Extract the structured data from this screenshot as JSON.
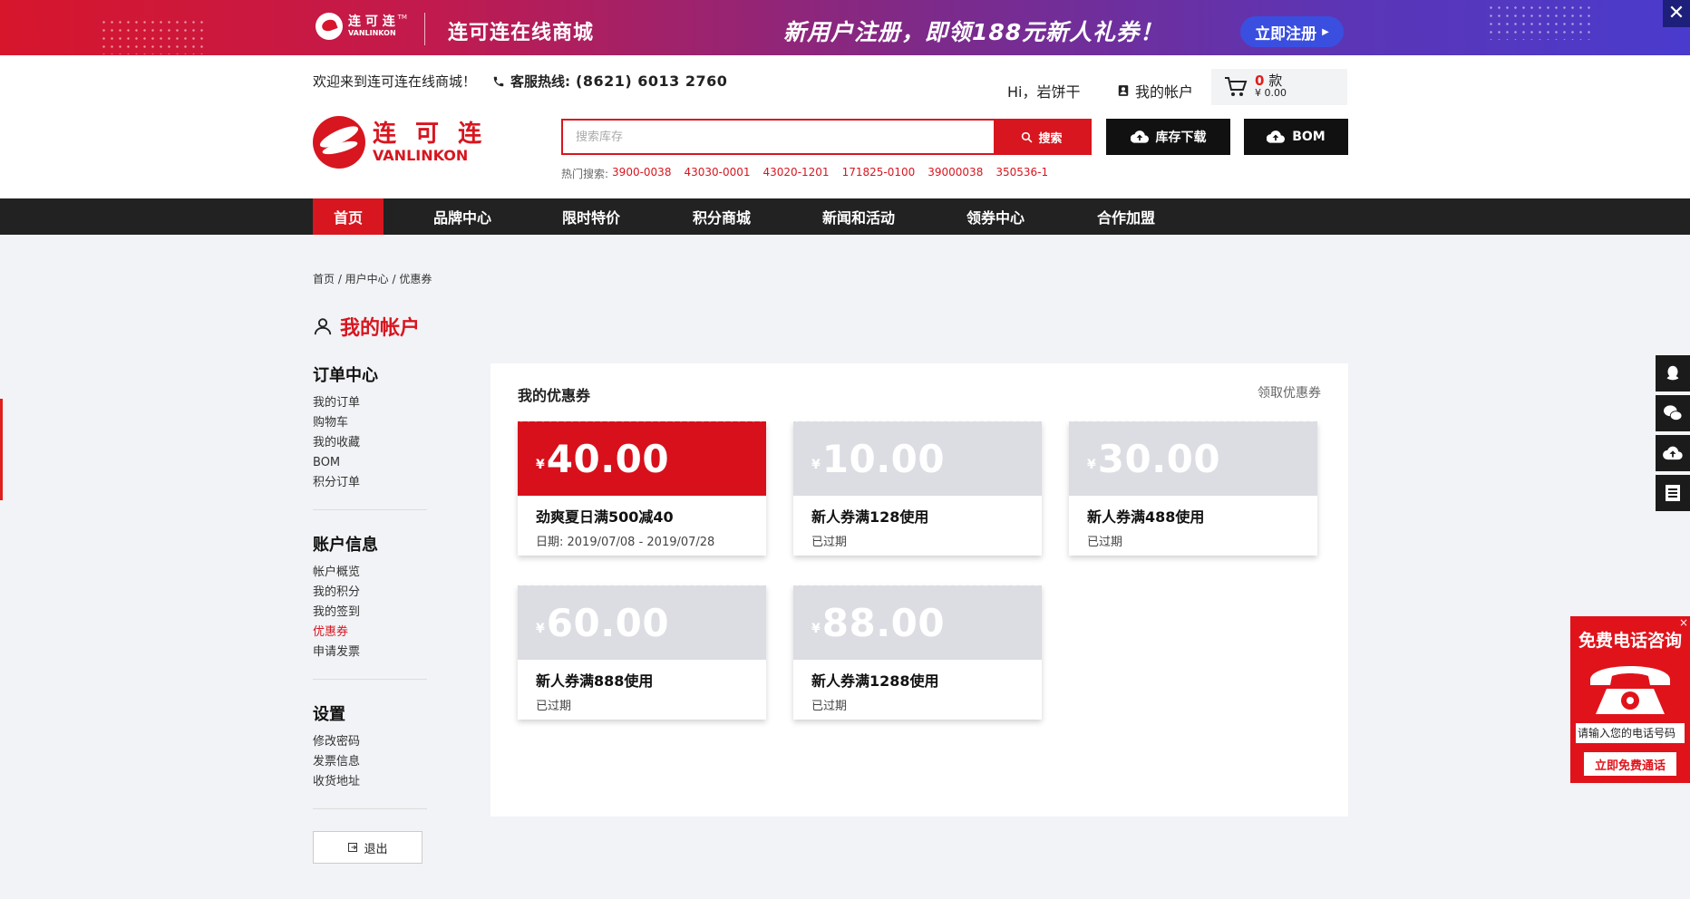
{
  "promo": {
    "logo_cn": "连 可 连",
    "logo_en": "VANLINKON",
    "logo_tm": "TM",
    "site_name": "连可连在线商城",
    "slogan": "新用户注册，即领188元新人礼券！",
    "register_btn": "立即注册",
    "close": "✕"
  },
  "header": {
    "welcome": "欢迎来到连可连在线商城！",
    "hotline_label": "客服热线:",
    "hotline_number": "(8621) 6013 2760",
    "greeting": "Hi，岩饼干",
    "account_link": "我的帐户",
    "cart_count_num": "0",
    "cart_count_unit": "款",
    "cart_price": "¥ 0.00",
    "logo_cn": "连 可 连",
    "logo_en": "VANLINKON"
  },
  "search": {
    "placeholder": "搜索库存",
    "button": "搜索",
    "stock_download": "库存下载",
    "bom": "BOM",
    "hot_label": "热门搜索:",
    "hot_keywords": [
      "3900-0038",
      "43030-0001",
      "43020-1201",
      "171825-0100",
      "39000038",
      "350536-1"
    ]
  },
  "nav": {
    "items": [
      "首页",
      "品牌中心",
      "限时特价",
      "积分商城",
      "新闻和活动",
      "领券中心",
      "合作加盟"
    ]
  },
  "breadcrumb": "首页 / 用户中心 / 优惠券",
  "account_title": "我的帐户",
  "sidebar": {
    "groups": [
      {
        "title": "订单中心",
        "items": [
          "我的订单",
          "购物车",
          "我的收藏",
          "BOM",
          "积分订单"
        ]
      },
      {
        "title": "账户信息",
        "items": [
          "帐户概览",
          "我的积分",
          "我的签到",
          "优惠券",
          "申请发票"
        ]
      },
      {
        "title": "设置",
        "items": [
          "修改密码",
          "发票信息",
          "收货地址"
        ]
      }
    ],
    "logout": "退出"
  },
  "panel": {
    "title": "我的优惠券",
    "get_coupon_link": "领取优惠券",
    "coupons": [
      {
        "currency": "¥",
        "amount": "40.00",
        "name": "劲爽夏日满500减40",
        "meta": "日期:  2019/07/08 - 2019/07/28",
        "status": "active"
      },
      {
        "currency": "¥",
        "amount": "10.00",
        "name": "新人券满128使用",
        "meta": "已过期",
        "status": "expired"
      },
      {
        "currency": "¥",
        "amount": "30.00",
        "name": "新人券满488使用",
        "meta": "已过期",
        "status": "expired"
      },
      {
        "currency": "¥",
        "amount": "60.00",
        "name": "新人券满888使用",
        "meta": "已过期",
        "status": "expired"
      },
      {
        "currency": "¥",
        "amount": "88.00",
        "name": "新人券满1288使用",
        "meta": "已过期",
        "status": "expired"
      }
    ]
  },
  "callbox": {
    "title": "免费电话咨询",
    "placeholder": "请输入您的电话号码",
    "button": "立即免费通话",
    "close": "×"
  },
  "colors": {
    "brand_red": "#d7161f",
    "nav_dark": "#222222",
    "expired_gray": "#dcdde2",
    "page_bg": "#f2f3f6"
  }
}
